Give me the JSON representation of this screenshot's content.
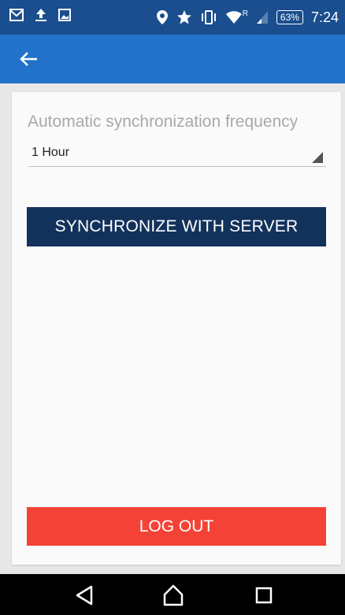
{
  "status_bar": {
    "time": "7:24",
    "battery": "63%",
    "icons_left": [
      "mail-icon",
      "upload-icon",
      "image-icon"
    ],
    "icons_right": [
      "location-icon",
      "star-icon",
      "vibrate-icon",
      "wifi-icon",
      "signal-icon"
    ],
    "roaming": "R"
  },
  "app_bar": {
    "back_icon": "arrow-left-icon",
    "color": "#2272c9"
  },
  "settings": {
    "frequency_label": "Automatic synchronization frequency",
    "frequency_value": "1 Hour",
    "sync_button": "SYNCHRONIZE WITH SERVER",
    "logout_button": "LOG OUT"
  },
  "colors": {
    "status_bar": "#1a4e8e",
    "sync_button": "#12325c",
    "logout_button": "#f44336"
  },
  "nav_bar": {
    "buttons": [
      "back-triangle-icon",
      "home-icon",
      "recents-icon"
    ]
  }
}
